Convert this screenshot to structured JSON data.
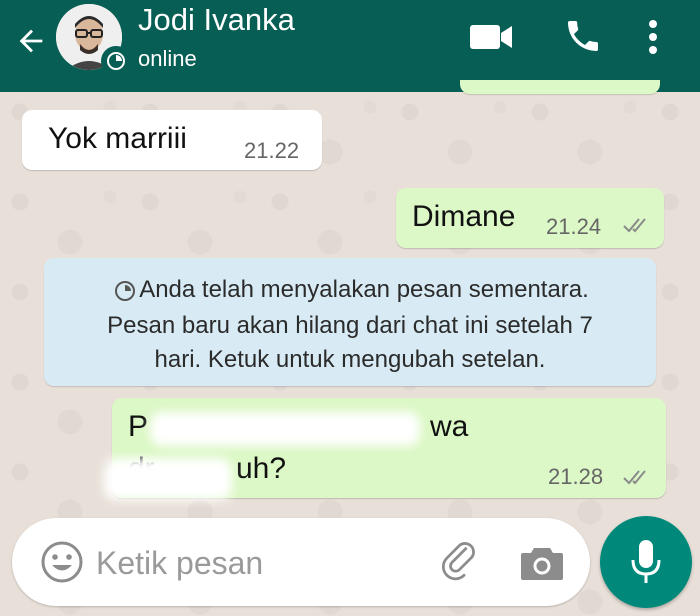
{
  "header": {
    "contact_name": "Jodi Ivanka",
    "status": "online"
  },
  "messages": [
    {
      "direction": "incoming",
      "text": "Yok marriii",
      "time": "21.22"
    },
    {
      "direction": "outgoing",
      "text": "Dimane",
      "time": "21.24",
      "status": "read"
    },
    {
      "direction": "outgoing",
      "text_line1_visible": [
        "P",
        "wa"
      ],
      "text_line2_visible": [
        "dr",
        "uh?"
      ],
      "time": "21.28",
      "status": "read",
      "partially_obscured": true
    }
  ],
  "system_notice": {
    "line1": "Anda telah menyalakan pesan sementara.",
    "line2": "Pesan baru akan hilang dari chat ini setelah 7",
    "line3": "hari. Ketuk untuk mengubah setelan."
  },
  "composer": {
    "placeholder": "Ketik pesan"
  },
  "icons": {
    "back": "arrow-back-icon",
    "video": "video-call-icon",
    "phone": "voice-call-icon",
    "menu": "more-vert-icon",
    "emoji": "emoji-icon",
    "attach": "attach-icon",
    "camera": "camera-icon",
    "mic": "mic-icon",
    "timer": "disappearing-timer-icon",
    "ticks": "double-check-icon"
  },
  "colors": {
    "header": "#075e54",
    "outgoing_bubble": "#dcf8c6",
    "incoming_bubble": "#ffffff",
    "system_bubble": "#d8ebf4",
    "mic_button": "#00897b"
  }
}
